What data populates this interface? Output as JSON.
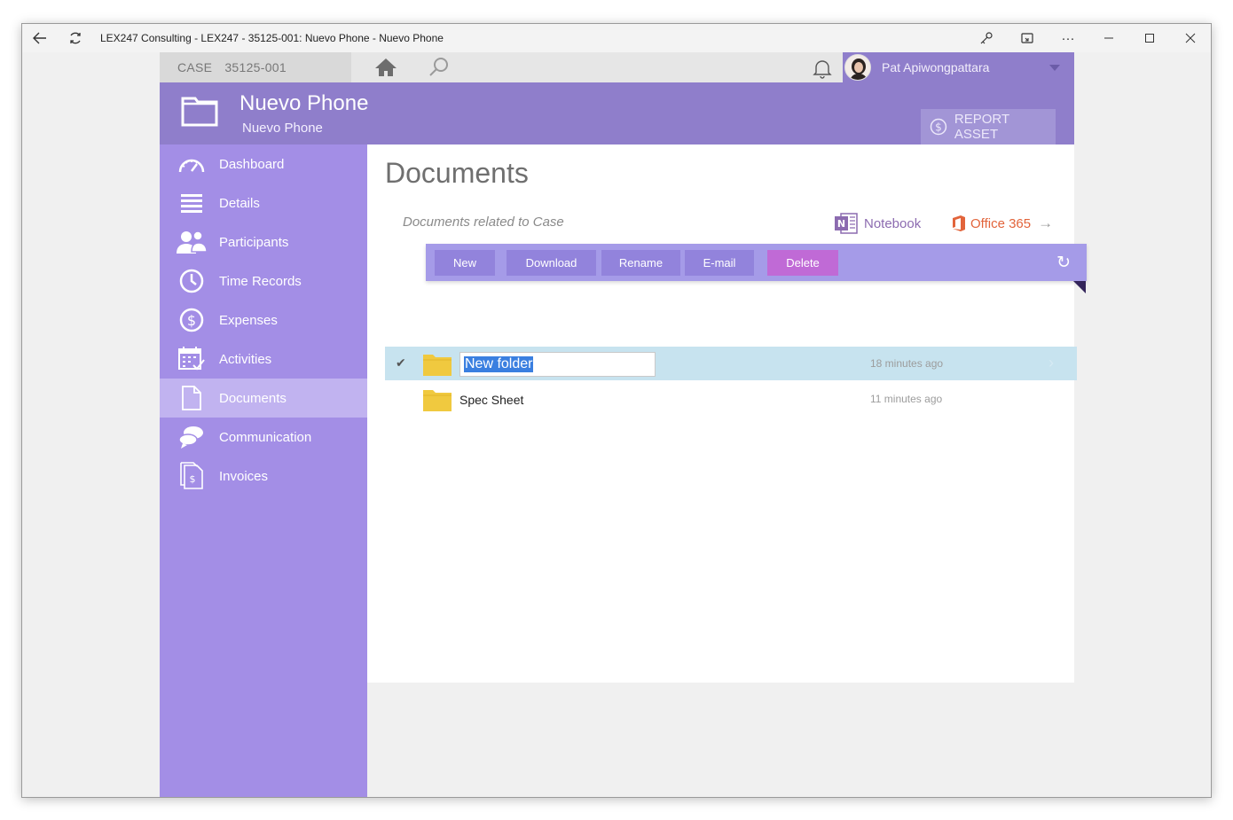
{
  "window": {
    "title": "LEX247 Consulting - LEX247 - 35125-001: Nuevo Phone - Nuevo Phone",
    "back_icon": "back-arrow-icon",
    "refresh_icon": "refresh-icon"
  },
  "topbar": {
    "case_label": "CASE",
    "case_number": "35125-001",
    "user_name": "Pat Apiwongpattara"
  },
  "header": {
    "title": "Nuevo Phone",
    "subtitle": "Nuevo Phone",
    "report_button": "REPORT ASSET"
  },
  "sidebar": {
    "items": [
      {
        "label": "Dashboard",
        "icon": "gauge-icon"
      },
      {
        "label": "Details",
        "icon": "list-icon"
      },
      {
        "label": "Participants",
        "icon": "people-icon"
      },
      {
        "label": "Time Records",
        "icon": "clock-icon"
      },
      {
        "label": "Expenses",
        "icon": "dollar-icon"
      },
      {
        "label": "Activities",
        "icon": "calendar-check-icon"
      },
      {
        "label": "Documents",
        "icon": "document-icon",
        "active": true
      },
      {
        "label": "Communication",
        "icon": "chat-icon"
      },
      {
        "label": "Invoices",
        "icon": "invoice-icon"
      }
    ]
  },
  "main": {
    "title": "Documents",
    "subtitle": "Documents related to Case",
    "notebook_label": "Notebook",
    "office_label": "Office 365",
    "toolbar": {
      "new": "New",
      "download": "Download",
      "rename": "Rename",
      "email": "E-mail",
      "delete": "Delete"
    },
    "rows": [
      {
        "name": "New folder",
        "time": "18 minutes ago",
        "selected": true,
        "editing": true
      },
      {
        "name": "Spec Sheet",
        "time": "11 minutes ago",
        "selected": false
      }
    ]
  },
  "colors": {
    "header": "#8f7ecb",
    "sidebar": "#a38ee6",
    "sidebar_active": "#c1b3f0",
    "toolbar": "#a59be8",
    "delete": "#c06ad6",
    "selected_row": "#c7e3ef",
    "folder": "#f0c93f"
  }
}
